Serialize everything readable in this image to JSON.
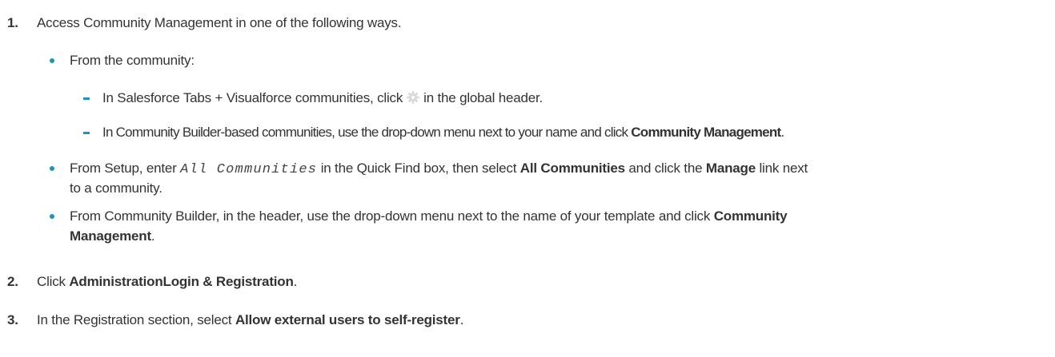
{
  "steps": [
    {
      "number": "1.",
      "text": "Access Community Management in one of the following ways.",
      "bullets": [
        {
          "text": "From the community:",
          "subitems": [
            {
              "pre": "In Salesforce Tabs + Visualforce communities, click",
              "icon": "gear-icon",
              "post": "in the global header."
            },
            {
              "pre": "In Community Builder-based communities, use the drop-down menu next to your name and click ",
              "bold": "Community Management",
              "post": "."
            }
          ]
        },
        {
          "pre": "From Setup, enter ",
          "code": "All Communities",
          "mid": " in the Quick Find box, then select ",
          "bold1": "All Communities",
          "mid2": " and click the ",
          "bold2": "Manage",
          "post": " link next",
          "cont": "to a community."
        },
        {
          "pre": "From Community Builder, in the header, use the drop-down menu next to the name of your template and click ",
          "bold": "Community",
          "bold_cont": "Management",
          "post": "."
        }
      ]
    },
    {
      "number": "2.",
      "pre": "Click ",
      "bold": "AdministrationLogin & Registration",
      "post": "."
    },
    {
      "number": "3.",
      "pre": "In the Registration section, select ",
      "bold": "Allow external users to self-register",
      "post": "."
    }
  ],
  "colors": {
    "text": "#333333",
    "accent": "#1797c0",
    "icon": "#d9d9d9"
  }
}
